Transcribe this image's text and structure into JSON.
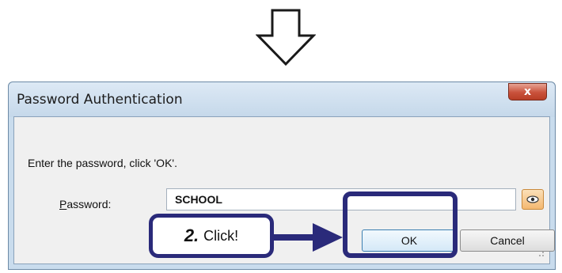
{
  "dialog": {
    "title": "Password Authentication",
    "close_label": "x",
    "prompt": "Enter the password, click 'OK'.",
    "password_label_mnemonic": "P",
    "password_label_rest": "assword:",
    "password_value": "SCHOOL",
    "ok_label": "OK",
    "cancel_label": "Cancel"
  },
  "annotation": {
    "step_number": "2.",
    "step_text": "Click!"
  },
  "colors": {
    "annotation": "#2a2a7a",
    "close_button": "#c9513b",
    "dialog_frame": "#c9dced"
  },
  "icons": [
    "down-arrow-icon",
    "eye-icon",
    "resize-grip-icon",
    "callout-arrow-icon"
  ]
}
